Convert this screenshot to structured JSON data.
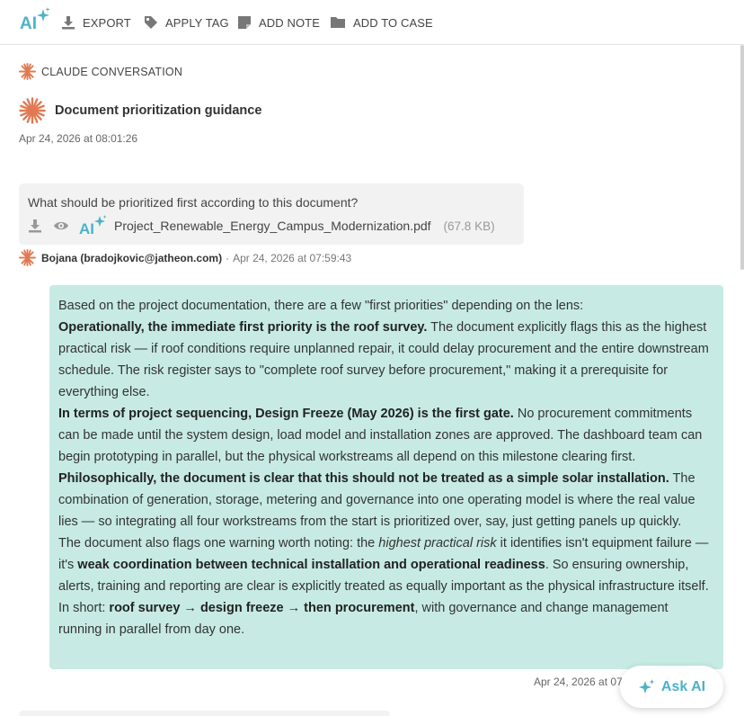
{
  "toolbar": {
    "logo_text": "AI",
    "export_label": "EXPORT",
    "apply_tag_label": "APPLY TAG",
    "add_note_label": "ADD NOTE",
    "add_to_case_label": "ADD TO CASE"
  },
  "conversation": {
    "source_label": "CLAUDE CONVERSATION",
    "title": "Document prioritization guidance",
    "date": "Apr 24, 2026 at 08:01:26"
  },
  "user_message": {
    "question": "What should be prioritized first according to this document?",
    "attachment_logo": "AI",
    "attachment_name": "Project_Renewable_Energy_Campus_Modernization.pdf",
    "attachment_size": "(67.8 KB)",
    "sender": "Bojana (bradojkovic@jatheon.com)",
    "sender_sep": "·",
    "timestamp": "Apr 24, 2026 at 07:59:43"
  },
  "assistant_message": {
    "intro": "Based on the project documentation, there are a few \"first priorities\" depending on the lens:",
    "p1_bold": "Operationally, the immediate first priority is the roof survey.",
    "p1_text": " The document explicitly flags this as the highest practical risk — if roof conditions require unplanned repair, it could delay procurement and the entire downstream schedule. The risk register says to \"complete roof survey before procurement,\" making it a prerequisite for everything else.",
    "p2_bold": "In terms of project sequencing, Design Freeze (May 2026) is the first gate.",
    "p2_text": " No procurement commitments can be made until the system design, load model and installation zones are approved. The dashboard team can begin prototyping in parallel, but the physical workstreams all depend on this milestone clearing first.",
    "p3_bold": "Philosophically, the document is clear that this should not be treated as a simple solar installation.",
    "p3_text": " The combination of generation, storage, metering and governance into one operating model is where the real value lies — so integrating all four workstreams from the start is prioritized over, say, just getting panels up quickly.",
    "p4_a": "The document also flags one warning worth noting: the ",
    "p4_italic": "highest practical risk",
    "p4_b": " it identifies isn't equipment failure — it's ",
    "p4_bold": "weak coordination between technical installation and operational readiness",
    "p4_c": ". So ensuring ownership, alerts, training and reporting are clear is explicitly treated as equally important as the physical infrastructure itself.",
    "p5_a": "In short: ",
    "p5_bold": "roof survey → design freeze → then procurement",
    "p5_b": ", with governance and change management running in parallel from day one.",
    "timestamp": "Apr 24, 2026 at 07"
  },
  "ask_ai": {
    "label": "Ask AI"
  },
  "colors": {
    "accent": "#4bb3c8",
    "claude_orange": "#e07a52",
    "assistant_bubble": "#c7ebe4",
    "user_bubble": "#f2f2f2"
  }
}
